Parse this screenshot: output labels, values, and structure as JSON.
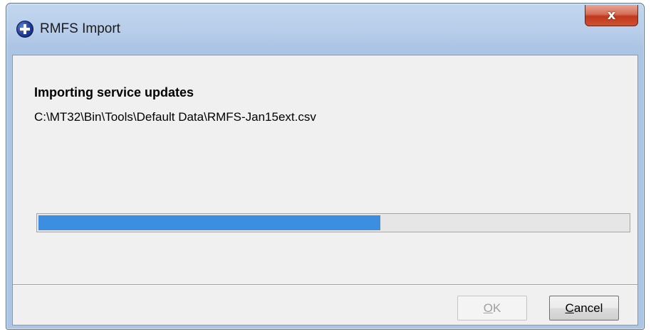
{
  "window": {
    "title": "RMFS Import",
    "close_glyph": "x"
  },
  "content": {
    "heading": "Importing service updates",
    "file_path": "C:\\MT32\\Bin\\Tools\\Default Data\\RMFS-Jan15ext.csv"
  },
  "progress": {
    "fraction": 0.58,
    "fill_color": "#3c8fe0"
  },
  "buttons": {
    "ok": {
      "accel": "O",
      "rest": "K",
      "enabled": false
    },
    "cancel": {
      "accel": "C",
      "rest": "ancel",
      "enabled": true
    }
  },
  "icons": {
    "app": "medical-cross-icon",
    "close": "close-icon"
  }
}
